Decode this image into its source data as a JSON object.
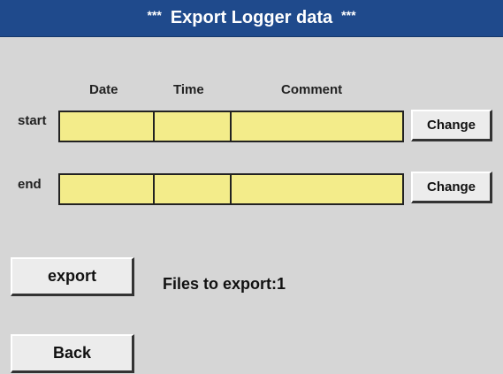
{
  "header": {
    "stars_left": "***",
    "title": "Export Logger data",
    "stars_right": "***"
  },
  "columns": {
    "date": "Date",
    "time": "Time",
    "comment": "Comment"
  },
  "rows": {
    "start": {
      "label": "start",
      "date": "",
      "time": "",
      "comment": "",
      "change_label": "Change"
    },
    "end": {
      "label": "end",
      "date": "",
      "time": "",
      "comment": "",
      "change_label": "Change"
    }
  },
  "actions": {
    "export_label": "export",
    "back_label": "Back"
  },
  "status": {
    "files_to_export": "Files to export:1"
  },
  "colors": {
    "title_bar": "#1f4a8c",
    "background": "#d6d6d6",
    "field_fill": "#f3ec8a"
  }
}
